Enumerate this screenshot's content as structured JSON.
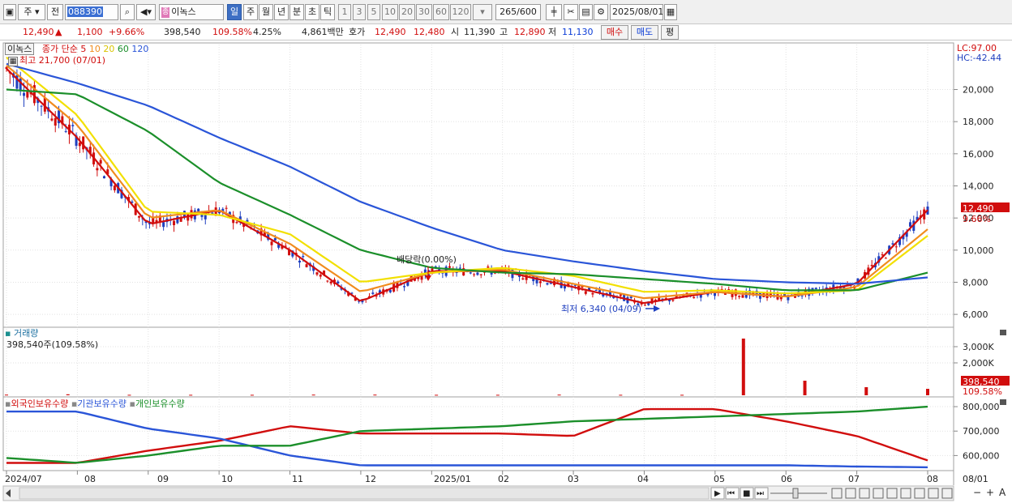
{
  "toolbar": {
    "period_type": "주",
    "prev_label": "전",
    "stock_code": "088390",
    "stock_name": "이녹스",
    "stock_badge": "종",
    "intervals": [
      "일",
      "주",
      "월",
      "년",
      "분",
      "초",
      "틱"
    ],
    "selected_interval": "일",
    "tick_counts": [
      "1",
      "3",
      "5",
      "10",
      "20",
      "30",
      "60",
      "120"
    ],
    "count_current": "265",
    "count_total": "/600",
    "date": "2025/08/01"
  },
  "quote": {
    "price": "12,490",
    "change_arrow": "▲",
    "change": "1,100",
    "change_pct": "+9.66%",
    "volume": "398,540",
    "volume_ratio": "109.58%",
    "turnover": "4.25%",
    "trade_value": "4,861백만",
    "ask_label": "호가",
    "ask": "12,490",
    "bid": "12,480",
    "open_label": "시",
    "open": "11,390",
    "high_label": "고",
    "high": "12,890",
    "low_label": "저",
    "low": "11,130",
    "buy_button": "매수",
    "sell_button": "매도",
    "avg_button": "평"
  },
  "price_pane": {
    "name": "이녹스",
    "ma_label": "종가 단순",
    "ma_periods": [
      "5",
      "10",
      "20",
      "60",
      "120"
    ],
    "ma_colors": [
      "#d10d0d",
      "#f08c1e",
      "#f2e000",
      "#1b8f2a",
      "#2a55d8"
    ],
    "high_note": "최고 21,700 (07/01)",
    "low_note": "최저 6,340 (04/09)",
    "dividend_note": "배당락(0.00%)",
    "lc": "LC:97.00",
    "hc": "HC:-42.44",
    "last_price_tag": "12,490",
    "last_pct_tag": "9.66%"
  },
  "volume_pane": {
    "title": "거래량",
    "sub": "398,540주(109.58%)",
    "last_tag": "398,540",
    "last_pct": "109.58%"
  },
  "holdings_pane": {
    "series": [
      "외국인보유수량",
      "기관보유수량",
      "개인보유수량"
    ]
  },
  "x_labels": [
    "2024/07",
    "08",
    "09",
    "10",
    "11",
    "12",
    "2025/01",
    "02",
    "03",
    "04",
    "05",
    "06",
    "07",
    "08",
    "08/01"
  ],
  "bottom_controls": [
    "▶",
    "⏮",
    "■",
    "⏭",
    "−",
    "+",
    "A"
  ],
  "chart_data": [
    {
      "type": "line",
      "title": "이녹스 종가 단순 5 10 20 60 120",
      "x": [
        "2024/07",
        "08",
        "09",
        "10",
        "11",
        "12",
        "2025/01",
        "02",
        "03",
        "04",
        "05",
        "06",
        "07",
        "08"
      ],
      "y_ticks": [
        6000,
        8000,
        10000,
        12000,
        14000,
        16000,
        18000,
        20000
      ],
      "ylim": [
        5300,
        22800
      ],
      "series": [
        {
          "name": "5",
          "color": "#d10d0d",
          "values": [
            21300,
            17000,
            11600,
            12500,
            10000,
            6800,
            8700,
            8700,
            7700,
            6700,
            7400,
            7100,
            7900,
            12500
          ]
        },
        {
          "name": "10",
          "color": "#f08c1e",
          "values": [
            21500,
            17800,
            12000,
            12500,
            10400,
            7400,
            8600,
            8800,
            7900,
            7000,
            7400,
            7100,
            7700,
            11300
          ]
        },
        {
          "name": "20",
          "color": "#f2e000",
          "values": [
            22000,
            18400,
            12400,
            12200,
            11000,
            8000,
            8600,
            8900,
            8400,
            7400,
            7500,
            7300,
            7500,
            10900
          ]
        },
        {
          "name": "60",
          "color": "#1b8f2a",
          "values": [
            20000,
            19700,
            17400,
            14200,
            12200,
            10000,
            8900,
            8600,
            8500,
            8200,
            7900,
            7500,
            7500,
            8600
          ]
        },
        {
          "name": "120",
          "color": "#2a55d8",
          "values": [
            21600,
            20400,
            19000,
            17000,
            15200,
            13000,
            11400,
            10000,
            9300,
            8700,
            8200,
            8000,
            7900,
            8300
          ]
        }
      ],
      "annotations": [
        "최고 21,700 (07/01)",
        "최저 6,340 (04/09)",
        "배당락(0.00%)"
      ]
    },
    {
      "type": "bar",
      "title": "거래량",
      "y_ticks": [
        2000000,
        3000000
      ],
      "ylim": [
        0,
        4000000
      ],
      "categories": [
        "2024/07",
        "08",
        "09",
        "10",
        "11",
        "12",
        "2025/01",
        "02",
        "03",
        "04",
        "05",
        "06",
        "07a",
        "07b",
        "07c",
        "08"
      ],
      "values": [
        40000,
        60000,
        30000,
        30000,
        30000,
        40000,
        40000,
        30000,
        30000,
        40000,
        30000,
        30000,
        3500000,
        900000,
        500000,
        398540
      ]
    },
    {
      "type": "line",
      "title": "외국인보유수량 기관보유수량 개인보유수량",
      "y_ticks": [
        600000,
        700000,
        800000
      ],
      "ylim": [
        545000,
        830000
      ],
      "x": [
        "2024/07",
        "08",
        "09",
        "10",
        "11",
        "12",
        "2025/01",
        "02",
        "03",
        "04",
        "05",
        "06",
        "07",
        "08"
      ],
      "series": [
        {
          "name": "외국인보유수량",
          "color": "#d10d0d",
          "values": [
            570000,
            570000,
            620000,
            660000,
            720000,
            690000,
            690000,
            690000,
            680000,
            790000,
            790000,
            740000,
            680000,
            580000
          ]
        },
        {
          "name": "기관보유수량",
          "color": "#2a55d8",
          "values": [
            780000,
            780000,
            710000,
            670000,
            600000,
            560000,
            560000,
            560000,
            560000,
            560000,
            560000,
            560000,
            555000,
            552000
          ]
        },
        {
          "name": "개인보유수량",
          "color": "#1b8f2a",
          "values": [
            590000,
            570000,
            600000,
            640000,
            640000,
            700000,
            710000,
            720000,
            740000,
            750000,
            760000,
            770000,
            780000,
            800000
          ]
        }
      ]
    }
  ]
}
